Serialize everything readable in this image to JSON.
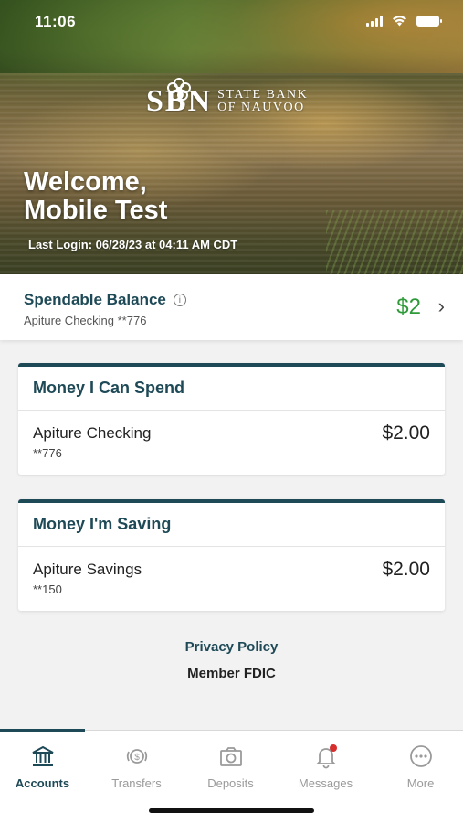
{
  "status": {
    "time": "11:06"
  },
  "hero": {
    "logo_letters": "SBN",
    "logo_line1": "STATE BANK",
    "logo_line2": "OF NAUVOO",
    "welcome_line1": "Welcome,",
    "welcome_line2": "Mobile Test",
    "last_login": "Last Login: 06/28/23 at 04:11 AM CDT"
  },
  "spendable": {
    "title": "Spendable Balance",
    "account": "Apiture Checking **776",
    "amount": "$2",
    "amount_color": "#2f9a3a"
  },
  "groups": [
    {
      "title": "Money I Can Spend",
      "accounts": [
        {
          "name": "Apiture Checking",
          "number": "**776",
          "balance": "$2.00"
        }
      ]
    },
    {
      "title": "Money I'm Saving",
      "accounts": [
        {
          "name": "Apiture Savings",
          "number": "**150",
          "balance": "$2.00"
        }
      ]
    }
  ],
  "footer": {
    "privacy": "Privacy Policy",
    "fdic": "Member FDIC"
  },
  "tabs": [
    {
      "label": "Accounts",
      "icon": "bank-icon",
      "active": true
    },
    {
      "label": "Transfers",
      "icon": "transfer-dollar-icon",
      "active": false
    },
    {
      "label": "Deposits",
      "icon": "camera-icon",
      "active": false
    },
    {
      "label": "Messages",
      "icon": "bell-icon",
      "active": false
    },
    {
      "label": "More",
      "icon": "more-dots-icon",
      "active": false
    }
  ],
  "colors": {
    "brand": "#1e4a57",
    "positive": "#2f9a3a",
    "notification": "#d62d2d"
  }
}
